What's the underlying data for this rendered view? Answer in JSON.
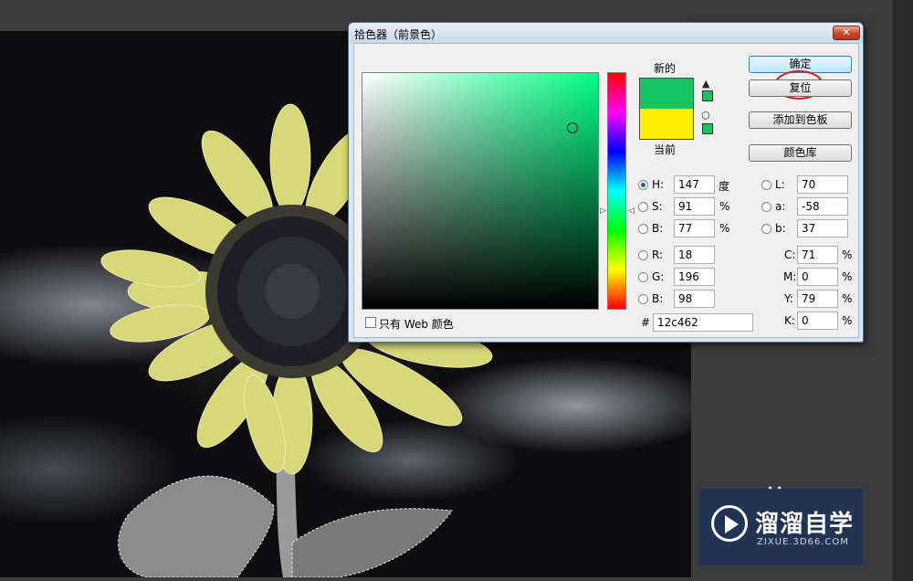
{
  "dialog": {
    "title": "拾色器（前景色）",
    "close_label": "✕",
    "new_label": "新的",
    "current_label": "当前",
    "new_color": "#12c462",
    "current_color": "#ffee00",
    "buttons": {
      "ok": "确定",
      "reset": "复位",
      "add_swatch": "添加到色板",
      "libraries": "颜色库"
    },
    "hsb": {
      "h_label": "H:",
      "h": "147",
      "h_unit": "度",
      "s_label": "S:",
      "s": "91",
      "s_unit": "%",
      "b_label": "B:",
      "b": "77",
      "b_unit": "%"
    },
    "rgb": {
      "r_label": "R:",
      "r": "18",
      "g_label": "G:",
      "g": "196",
      "b_label": "B:",
      "b": "98"
    },
    "lab": {
      "l_label": "L:",
      "l": "70",
      "a_label": "a:",
      "a": "-58",
      "b_label": "b:",
      "b": "37"
    },
    "cmyk": {
      "c_label": "C:",
      "c": "71",
      "m_label": "M:",
      "m": "0",
      "y_label": "Y:",
      "y": "79",
      "k_label": "K:",
      "k": "0",
      "unit": "%"
    },
    "hex_label": "#",
    "hex": "12c462",
    "web_only_label": "只有 Web 颜色",
    "web_only_checked": false,
    "selected_mode": "H"
  },
  "watermark": {
    "name": "溜溜自学",
    "url": "ZIXUE.3D66.COM"
  }
}
